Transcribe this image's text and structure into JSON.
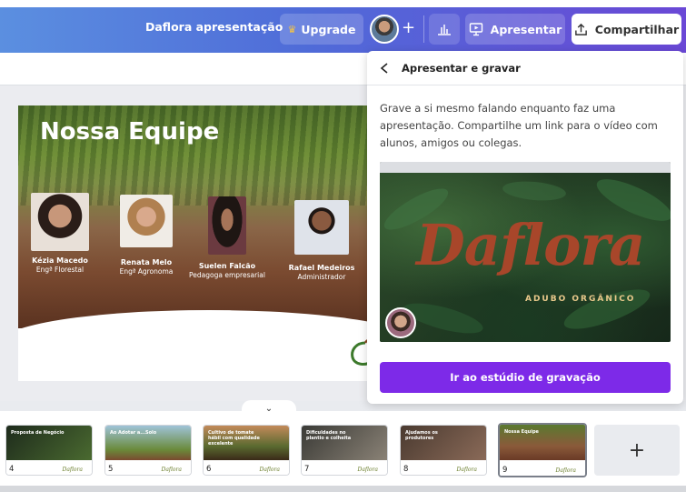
{
  "topbar": {
    "doc_title": "Daflora apresentação",
    "upgrade_label": "Upgrade",
    "present_label": "Apresentar",
    "share_label": "Compartilhar"
  },
  "slide": {
    "title": "Nossa Equipe",
    "members": [
      {
        "name": "Kézia Macedo",
        "role": "Engª Florestal"
      },
      {
        "name": "Renata Melo",
        "role": "Engª Agronoma"
      },
      {
        "name": "Suelen Falcão",
        "role": "Pedagoga empresarial"
      },
      {
        "name": "Rafael Medeiros",
        "role": "Administrador"
      }
    ]
  },
  "panel": {
    "title": "Apresentar e gravar",
    "description": "Grave a si mesmo falando enquanto faz uma apresentação. Compartilhe um link para o vídeo com alunos, amigos ou colegas.",
    "preview_brand": "Daflora",
    "preview_tagline": "ADUBO ORGÂNICO",
    "record_button": "Ir ao estúdio de gravação"
  },
  "thumbnails": [
    {
      "num": "4",
      "title": "Proposta de Negócio"
    },
    {
      "num": "5",
      "title": "Ao Adotar a...Solo"
    },
    {
      "num": "6",
      "title": "Cultivo de tomate hábil com qualidade excelente"
    },
    {
      "num": "7",
      "title": "Dificuldades no plantio e colheita"
    },
    {
      "num": "8",
      "title": "Ajudamos os produtores"
    },
    {
      "num": "9",
      "title": "Nossa Equipe"
    }
  ],
  "thumbnail_signature": "Daflora"
}
